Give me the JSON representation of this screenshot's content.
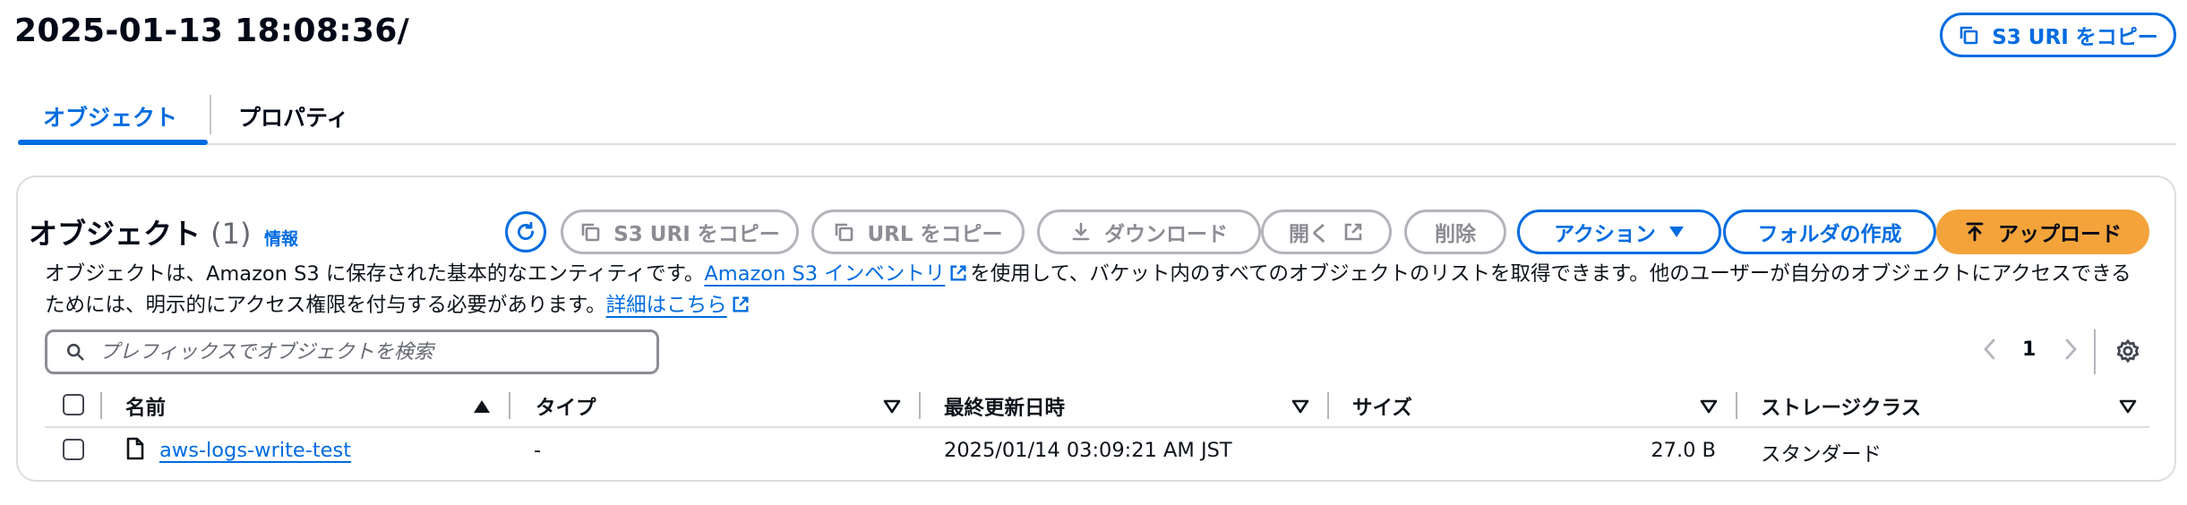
{
  "header": {
    "title": "2025-01-13 18:08:36/",
    "copy_s3_uri_label": "S3 URI をコピー"
  },
  "tabs": [
    {
      "label": "オブジェクト",
      "active": true
    },
    {
      "label": "プロパティ",
      "active": false
    }
  ],
  "objects_panel": {
    "title": "オブジェクト",
    "count": "(1)",
    "info_label": "情報",
    "toolbar": {
      "copy_s3_uri": "S3 URI をコピー",
      "copy_url": "URL をコピー",
      "download": "ダウンロード",
      "open": "開く",
      "delete": "削除",
      "actions": "アクション",
      "create_folder": "フォルダの作成",
      "upload": "アップロード"
    },
    "description": {
      "part1": "オブジェクトは、Amazon S3 に保存された基本的なエンティティです。",
      "inventory_link": "Amazon S3 インベントリ",
      "part2": "を使用して、バケット内のすべてのオブジェクトのリストを取得できます。他のユーザーが自分のオブジェクトにアクセスできるためには、明示的にアクセス権限を付与する必要があります。",
      "details_link": "詳細はこちら"
    },
    "search": {
      "placeholder": "プレフィックスでオブジェクトを検索",
      "value": ""
    },
    "pagination": {
      "current_page": "1"
    },
    "table": {
      "columns": [
        "名前",
        "タイプ",
        "最終更新日時",
        "サイズ",
        "ストレージクラス"
      ],
      "rows": [
        {
          "name": "aws-logs-write-test",
          "type": "-",
          "last_modified": "2025/01/14 03:09:21 AM JST",
          "size": "27.0 B",
          "storage_class": "スタンダード"
        }
      ]
    }
  },
  "colors": {
    "accent": "#006ce0",
    "primary_button": "#f3a33a",
    "disabled": "#8c8c94",
    "border": "#dcdde0"
  },
  "icons": [
    "copy-icon",
    "refresh-icon",
    "download-icon",
    "external-link-icon",
    "caret-down-icon",
    "upload-icon",
    "search-icon",
    "chevron-left-icon",
    "chevron-right-icon",
    "settings-icon",
    "file-icon",
    "sort-ascending-icon",
    "sort-descending-icon"
  ]
}
